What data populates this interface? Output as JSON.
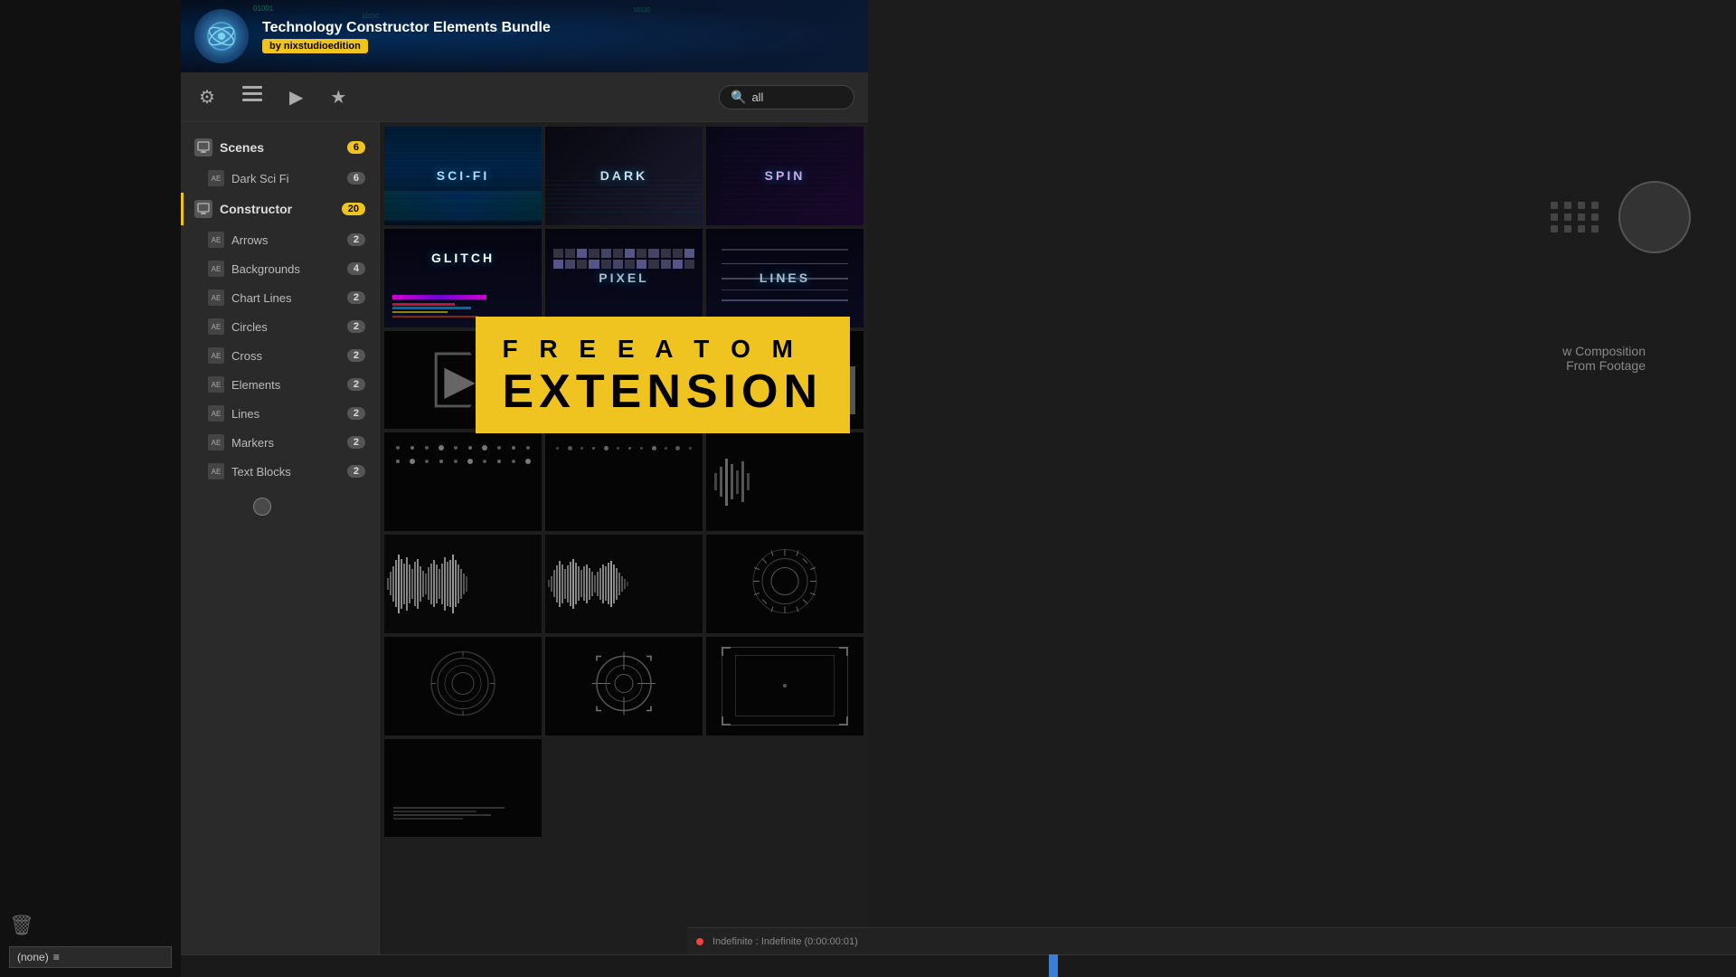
{
  "app": {
    "title": "Technology Constructor Elements Bundle",
    "by": "by nixstudioedition"
  },
  "toolbar": {
    "search_placeholder": "all",
    "search_value": "all",
    "icons": [
      "mixer-icon",
      "list-icon",
      "play-icon",
      "star-icon"
    ]
  },
  "sidebar": {
    "sections": [
      {
        "id": "scenes",
        "label": "Scenes",
        "badge": "6",
        "badge_type": "yellow"
      },
      {
        "id": "dark-sci-fi",
        "label": "Dark Sci Fi",
        "badge": "6",
        "badge_type": "gray",
        "indent": true
      },
      {
        "id": "constructor",
        "label": "Constructor",
        "badge": "20",
        "badge_type": "yellow"
      },
      {
        "id": "arrows",
        "label": "Arrows",
        "badge": "2",
        "badge_type": "gray",
        "indent": true
      },
      {
        "id": "backgrounds",
        "label": "Backgrounds",
        "badge": "4",
        "badge_type": "gray",
        "indent": true
      },
      {
        "id": "chart-lines",
        "label": "Chart Lines",
        "badge": "2",
        "badge_type": "gray",
        "indent": true
      },
      {
        "id": "circles",
        "label": "Circles",
        "badge": "2",
        "badge_type": "gray",
        "indent": true
      },
      {
        "id": "cross",
        "label": "Cross",
        "badge": "2",
        "badge_type": "gray",
        "indent": true
      },
      {
        "id": "elements",
        "label": "Elements",
        "badge": "2",
        "badge_type": "gray",
        "indent": true
      },
      {
        "id": "lines",
        "label": "Lines",
        "badge": "2",
        "badge_type": "gray",
        "indent": true
      },
      {
        "id": "markers",
        "label": "Markers",
        "badge": "2",
        "badge_type": "gray",
        "indent": true
      },
      {
        "id": "text-blocks",
        "label": "Text Blocks",
        "badge": "2",
        "badge_type": "gray",
        "indent": true
      }
    ]
  },
  "grid": {
    "items": [
      {
        "id": "scifi",
        "label": "SCI-FI",
        "type": "labeled"
      },
      {
        "id": "dark",
        "label": "DARK",
        "type": "labeled"
      },
      {
        "id": "spin",
        "label": "SPIN",
        "type": "labeled"
      },
      {
        "id": "glitch",
        "label": "GLITCH",
        "type": "labeled-color"
      },
      {
        "id": "pixel",
        "label": "PIXEL",
        "type": "labeled"
      },
      {
        "id": "lines",
        "label": "LINES",
        "type": "labeled"
      },
      {
        "id": "arrow1",
        "label": "",
        "type": "arrow-outline"
      },
      {
        "id": "arrow2",
        "label": "",
        "type": "arrow-solid"
      },
      {
        "id": "bars1",
        "label": "",
        "type": "bars"
      },
      {
        "id": "dots1",
        "label": "",
        "type": "dots"
      },
      {
        "id": "dots2",
        "label": "",
        "type": "dots2"
      },
      {
        "id": "bars2",
        "label": "",
        "type": "empty"
      },
      {
        "id": "audio1",
        "label": "",
        "type": "audio"
      },
      {
        "id": "audio2",
        "label": "",
        "type": "audio2"
      },
      {
        "id": "radial",
        "label": "",
        "type": "radial"
      },
      {
        "id": "circle1",
        "label": "",
        "type": "circle1"
      },
      {
        "id": "target",
        "label": "",
        "type": "target"
      },
      {
        "id": "frame",
        "label": "",
        "type": "frame"
      },
      {
        "id": "text1",
        "label": "",
        "type": "text-data"
      }
    ]
  },
  "overlay": {
    "line1": "F R E E  A T O M",
    "line2": "EXTENSION"
  },
  "right_panel": {
    "text1": "w Composition",
    "text2": "From Footage"
  },
  "bottom": {
    "none_label": "(none)",
    "time_label": "Indefinite : Indefinite (0:00:00:01)"
  }
}
